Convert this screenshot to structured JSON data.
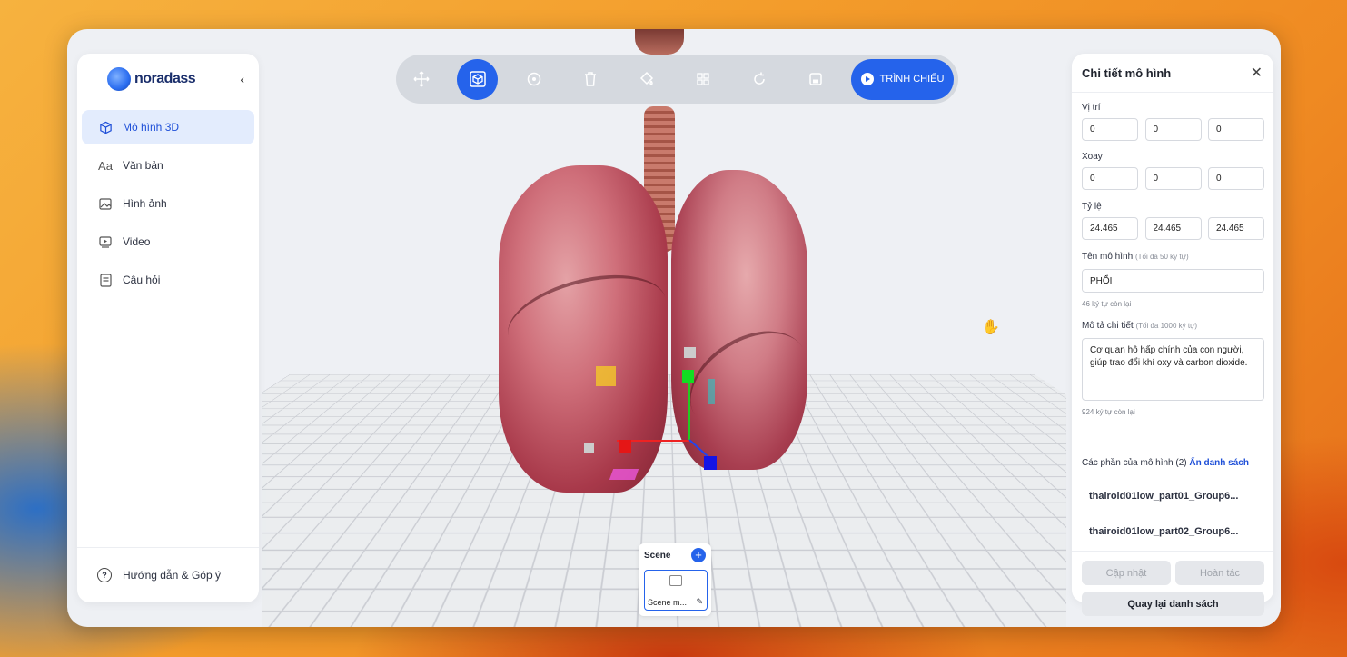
{
  "sidebar": {
    "logo_text": "noradass",
    "collapse_icon": "‹",
    "items": [
      {
        "label": "Mô hình 3D",
        "icon": "cube-icon",
        "active": true
      },
      {
        "label": "Văn bản",
        "icon": "text-icon"
      },
      {
        "label": "Hình ảnh",
        "icon": "image-icon"
      },
      {
        "label": "Video",
        "icon": "video-icon"
      },
      {
        "label": "Câu hỏi",
        "icon": "question-list-icon"
      }
    ],
    "help_label": "Hướng dẫn & Góp ý"
  },
  "toolbar": {
    "tools": [
      "move-icon",
      "select-model-icon",
      "rotate-view-icon",
      "delete-icon",
      "paint-bucket-icon",
      "grid-icon",
      "redo-icon",
      "save-icon"
    ],
    "active_tool": "select-model-icon",
    "present_label": "TRÌNH CHIẾU"
  },
  "scene": {
    "title": "Scene",
    "add_icon": "+",
    "thumb_name": "Scene m...",
    "edit_icon": "✎"
  },
  "panel": {
    "title": "Chi tiết mô hình",
    "close_icon": "✕",
    "position_label": "Vị trí",
    "position": [
      "0",
      "0",
      "0"
    ],
    "rotation_label": "Xoay",
    "rotation": [
      "0",
      "0",
      "0"
    ],
    "scale_label": "Tỷ lệ",
    "scale": [
      "24.465",
      "24.465",
      "24.465"
    ],
    "name_label": "Tên mô hình",
    "name_hint": "(Tối đa 50 ký tự)",
    "name_value": "PHỔI",
    "name_counter": "46 ký tự còn lại",
    "desc_label": "Mô tả chi tiết",
    "desc_hint": "(Tối đa 1000 ký tự)",
    "desc_value": "Cơ quan hô hấp chính của con người, giúp trao đổi khí oxy và carbon dioxide.",
    "desc_counter": "924 ký tự còn lại",
    "parts_label": "Các phần của mô hình (2)",
    "parts_toggle": "Ẩn danh sách",
    "parts": [
      "thairoid01low_part01_Group6...",
      "thairoid01low_part02_Group6..."
    ],
    "update_label": "Cập nhật",
    "undo_label": "Hoàn tác",
    "back_label": "Quay lại danh sách"
  }
}
